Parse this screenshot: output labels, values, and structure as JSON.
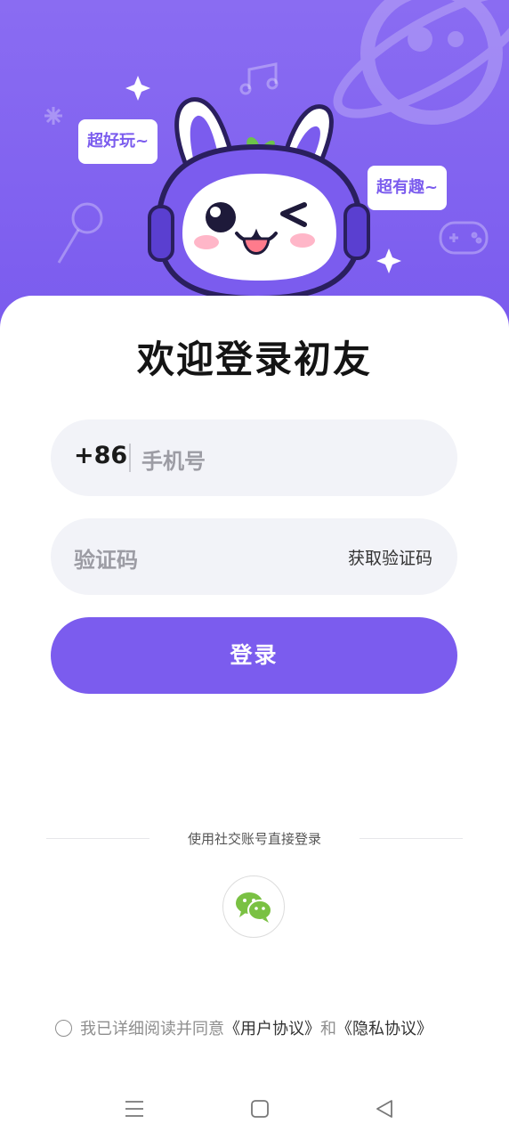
{
  "colors": {
    "accent": "#7b5cee",
    "hero_bg": "#8a6cf2",
    "field_bg": "#f2f3f8",
    "wechat_green": "#7ac143"
  },
  "hero": {
    "bubble_left": "超好玩~",
    "bubble_right": "超有趣~"
  },
  "title": "欢迎登录初友",
  "phone": {
    "country_code": "+86",
    "placeholder": "手机号"
  },
  "code": {
    "placeholder": "验证码",
    "get_code_label": "获取验证码"
  },
  "login_label": "登录",
  "social": {
    "title": "使用社交账号直接登录",
    "icon": "wechat-icon"
  },
  "agreement": {
    "prefix": "我已详细阅读并同意",
    "user_agreement": "《用户协议》",
    "and": "和",
    "privacy_policy": "《隐私协议》"
  },
  "navbar": {
    "icons": [
      "menu-icon",
      "home-icon",
      "back-icon"
    ]
  }
}
